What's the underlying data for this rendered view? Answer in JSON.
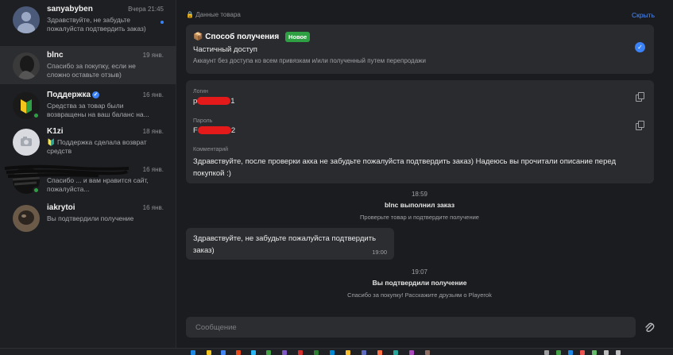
{
  "sidebar": {
    "chats": [
      {
        "name": "sanyabyben",
        "time": "Вчера 21:45",
        "message": "Здравствуйте, не забудьте пожалуйста подтвердить заказ)",
        "unread": true,
        "verified": false,
        "online": false,
        "avatar": "default-avatar"
      },
      {
        "name": "blnc",
        "time": "19 янв.",
        "message": "Спасибо за покупку, если не сложно оставьте отзыв)",
        "unread": false,
        "verified": false,
        "online": false,
        "avatar": "photo-avatar"
      },
      {
        "name": "Поддержка",
        "time": "16 янв.",
        "message": "Средства за товар были возвращены на ваш баланс на...",
        "unread": false,
        "verified": true,
        "online": true,
        "avatar": "support-logo"
      },
      {
        "name": "K1zi",
        "time": "18 янв.",
        "message": "🔰 Поддержка сделала возврат средств",
        "unread": false,
        "verified": false,
        "online": false,
        "avatar": "camera-avatar"
      },
      {
        "name": "",
        "time": "16 янв.",
        "message": "Спасибо ... и вам нравится сайт, пожалуйста...",
        "unread": false,
        "verified": false,
        "online": true,
        "avatar": "scribbled-avatar"
      },
      {
        "name": "iakrytoi",
        "time": "16 янв.",
        "message": "Вы подтвердили получение",
        "unread": false,
        "verified": false,
        "online": false,
        "avatar": "photo-avatar"
      }
    ]
  },
  "main": {
    "section_label": "Данные товара",
    "copy_link": "Скрыть",
    "delivery": {
      "title": "Способ получения",
      "badge": "Новое",
      "option": "Частичный доступ",
      "description": "Аккаунт без доступа ко всем привязкам и/или полученный путем перепродажи"
    },
    "credentials": {
      "login_label": "Логин",
      "login_prefix": "p",
      "login_suffix": "1",
      "password_label": "Пароль",
      "password_prefix": "F",
      "password_suffix": "2",
      "comment_label": "Комментарий",
      "comment": "Здравствуйте, после проверки акка не забудьте пожалуйста подтвердить заказ) Надеюсь вы прочитали описание перед покупкой :)"
    },
    "events": [
      {
        "time": "18:59",
        "title": "blnc выполнил заказ",
        "subtitle": "Проверьте товар и подтвердите получение"
      },
      {
        "time": "19:07",
        "title": "Вы подтвердили получение",
        "subtitle": "Спасибо за покупку! Расскажите друзьям о Playerok"
      }
    ],
    "bubble": {
      "text": "Здравствуйте, не забудьте пожалуйста подтвердить заказ)",
      "time": "19:00"
    },
    "composer_placeholder": "Сообщение"
  },
  "colors": {
    "accent": "#3b82f6",
    "badge": "#2ea043",
    "redaction": "#e41a1a",
    "background": "#1b1c1f",
    "card": "#2a2b2f"
  }
}
